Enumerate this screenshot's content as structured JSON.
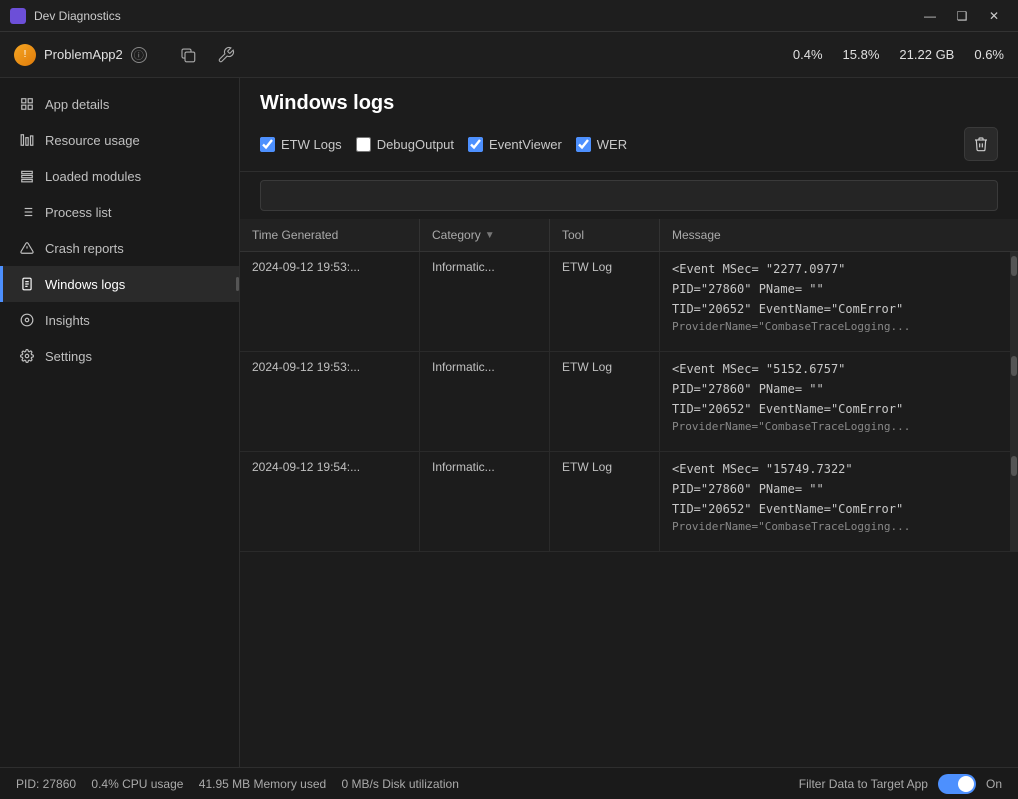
{
  "titlebar": {
    "icon": "DD",
    "title": "Dev Diagnostics",
    "min_btn": "—",
    "max_btn": "❑",
    "close_btn": "✕"
  },
  "appbar": {
    "app_icon": "!",
    "app_name": "ProblemApp2",
    "cpu": "0.4%",
    "memory": "15.8%",
    "disk": "21.22 GB",
    "network": "0.6%",
    "copy_icon": "⊡",
    "tools_icon": "⚙"
  },
  "sidebar": {
    "items": [
      {
        "id": "app-details",
        "label": "App details",
        "icon": "≡"
      },
      {
        "id": "resource-usage",
        "label": "Resource usage",
        "icon": "⊞"
      },
      {
        "id": "loaded-modules",
        "label": "Loaded modules",
        "icon": "⊟"
      },
      {
        "id": "process-list",
        "label": "Process list",
        "icon": "☰"
      },
      {
        "id": "crash-reports",
        "label": "Crash reports",
        "icon": "⚠"
      },
      {
        "id": "windows-logs",
        "label": "Windows logs",
        "icon": "⊡",
        "active": true
      },
      {
        "id": "insights",
        "label": "Insights",
        "icon": "◎"
      },
      {
        "id": "settings",
        "label": "Settings",
        "icon": "⚙"
      }
    ]
  },
  "content": {
    "title": "Windows logs",
    "filters": {
      "etw_logs": {
        "label": "ETW Logs",
        "checked": true
      },
      "debug_output": {
        "label": "DebugOutput",
        "checked": false
      },
      "event_viewer": {
        "label": "EventViewer",
        "checked": true
      },
      "wer": {
        "label": "WER",
        "checked": true
      }
    },
    "delete_label": "🗑",
    "search_placeholder": "",
    "table": {
      "headers": [
        {
          "label": "Time Generated"
        },
        {
          "label": "Category",
          "sortable": true
        },
        {
          "label": "Tool"
        },
        {
          "label": "Message"
        }
      ],
      "rows": [
        {
          "time": "2024-09-12 19:53:...",
          "category": "Informatic...",
          "tool": "ETW Log",
          "message_lines": [
            "<Event MSec=  \"2277.0977\"",
            "PID=\"27860\" PName=  \"\"",
            "TID=\"20652\" EventName=\"ComError\"",
            "ProviderName=\"CombaseTraceLogging..."
          ]
        },
        {
          "time": "2024-09-12 19:53:...",
          "category": "Informatic...",
          "tool": "ETW Log",
          "message_lines": [
            "<Event MSec=  \"5152.6757\"",
            "PID=\"27860\" PName=  \"\"",
            "TID=\"20652\" EventName=\"ComError\"",
            "ProviderName=\"CombaseTraceLogging..."
          ]
        },
        {
          "time": "2024-09-12 19:54:...",
          "category": "Informatic...",
          "tool": "ETW Log",
          "message_lines": [
            "<Event MSec=  \"15749.7322\"",
            "PID=\"27860\" PName=  \"\"",
            "TID=\"20652\" EventName=\"ComError\"",
            "ProviderName=\"CombaseTraceLogging..."
          ]
        }
      ]
    }
  },
  "statusbar": {
    "pid_label": "PID: 27860",
    "cpu_usage": "0.4% CPU usage",
    "memory_used": "41.95 MB Memory used",
    "disk_util": "0 MB/s Disk utilization",
    "filter_label": "Filter Data to Target App",
    "toggle_state": "On"
  }
}
